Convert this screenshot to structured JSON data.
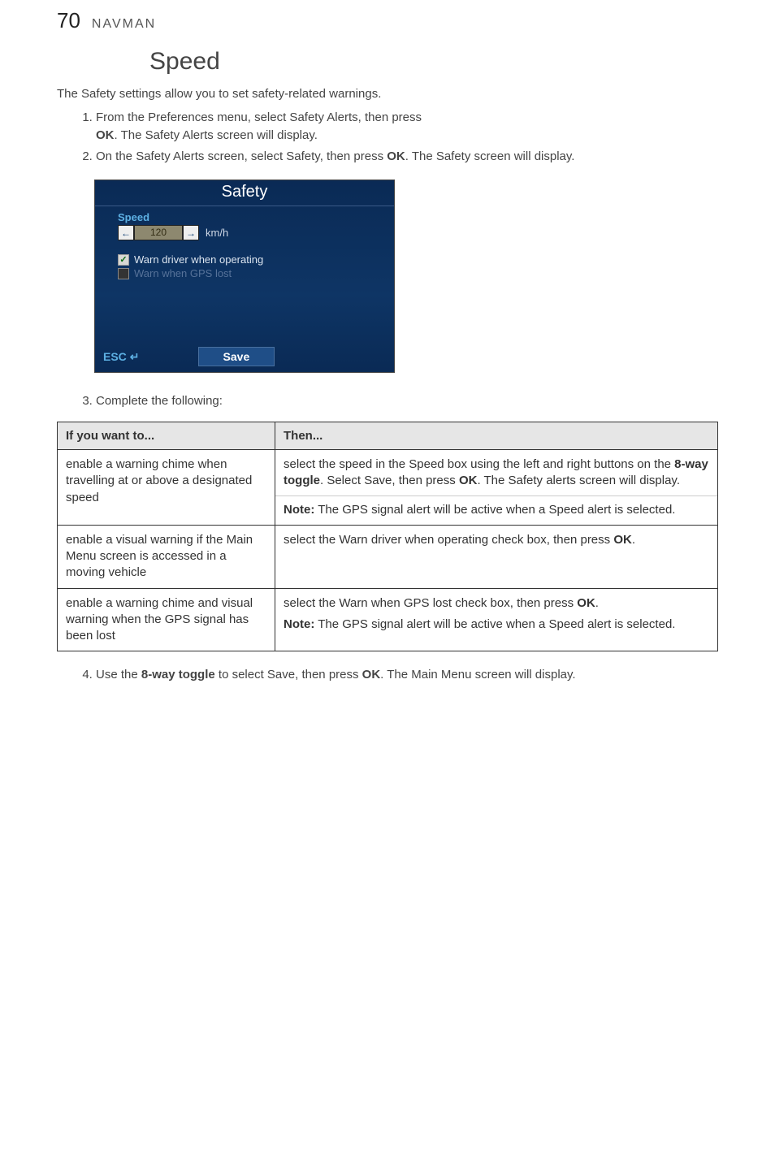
{
  "header": {
    "page_number": "70",
    "brand": "NAVMAN"
  },
  "section_title": "Speed",
  "intro_text": "The Safety settings allow you to set safety-related warnings.",
  "steps": {
    "s1_a": "From the Preferences menu, select Safety Alerts, then press",
    "s1_ok": "OK",
    "s1_b": ". The Safety Alerts screen will display.",
    "s2_a": "On the Safety Alerts screen, select Safety, then press ",
    "s2_ok": "OK",
    "s2_b": ". The Safety screen will display.",
    "s3": "Complete the following:",
    "s4_a": "Use the ",
    "s4_toggle": "8-way toggle",
    "s4_b": " to select Save, then press ",
    "s4_ok": "OK",
    "s4_c": ". The Main Menu screen will display."
  },
  "screenshot": {
    "title": "Safety",
    "speed_label": "Speed",
    "left_arrow": "←",
    "speed_value": "120",
    "right_arrow": "→",
    "unit": "km/h",
    "cb1_label": "Warn driver when operating",
    "cb2_label": "Warn when GPS lost",
    "esc_label": "ESC",
    "esc_icon": "↵",
    "save_label": "Save"
  },
  "table": {
    "header_left": "If you want to...",
    "header_right": "Then...",
    "rows": [
      {
        "left": "enable a warning chime when travelling at or above a designated speed",
        "right_a": "select the speed in the Speed box using the left and right buttons on the ",
        "right_b_bold": "8-way toggle",
        "right_c": ". Select Save, then press ",
        "right_d_bold": "OK",
        "right_e": ". The Safety alerts screen will display.",
        "note_label": "Note:",
        "note_text": " The GPS signal alert will be active when a Speed alert is selected."
      },
      {
        "left": "enable a visual warning if the Main Menu screen is accessed in a moving vehicle",
        "right_a": "select the Warn driver when operating check box, then press ",
        "right_b_bold": "OK",
        "right_c": "."
      },
      {
        "left": "enable a warning chime and visual warning when the GPS signal has been lost",
        "right_a": "select the Warn when GPS lost check box, then press ",
        "right_b_bold": "OK",
        "right_c": ".",
        "note_label": "Note:",
        "note_text": " The GPS signal alert will be active when a Speed alert is selected."
      }
    ]
  }
}
